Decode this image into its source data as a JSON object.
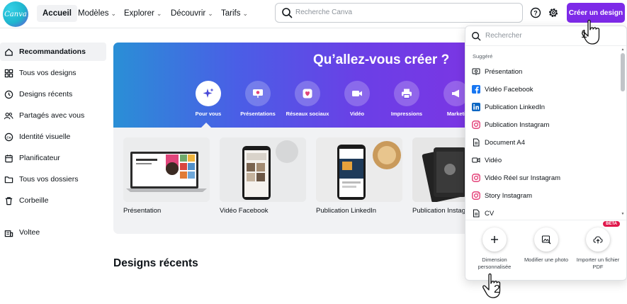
{
  "brand": {
    "logo_text": "Canva",
    "accent": "#7d2ae8"
  },
  "topnav": {
    "items": [
      {
        "label": "Accueil",
        "active": true
      },
      {
        "label": "Modèles",
        "dropdown": true
      },
      {
        "label": "Explorer",
        "dropdown": true
      },
      {
        "label": "Découvrir",
        "dropdown": true
      },
      {
        "label": "Tarifs",
        "dropdown": true
      }
    ],
    "search_placeholder": "Recherche Canva",
    "create_button": "Créer un design"
  },
  "sidebar": {
    "items": [
      {
        "label": "Recommandations",
        "icon": "home-icon",
        "active": true
      },
      {
        "label": "Tous vos designs",
        "icon": "grid-icon"
      },
      {
        "label": "Designs récents",
        "icon": "clock-icon"
      },
      {
        "label": "Partagés avec vous",
        "icon": "people-icon"
      },
      {
        "label": "Identité visuelle",
        "icon": "brand-icon"
      },
      {
        "label": "Planificateur",
        "icon": "calendar-icon"
      },
      {
        "label": "Tous vos dossiers",
        "icon": "folder-icon"
      },
      {
        "label": "Corbeille",
        "icon": "trash-icon"
      },
      {
        "label": "Voltee",
        "icon": "team-icon"
      }
    ]
  },
  "hero": {
    "title": "Qu’allez-vous créer ?",
    "categories": [
      {
        "label": "Pour vous",
        "icon": "sparkle-icon",
        "active": true
      },
      {
        "label": "Présentations",
        "icon": "presentation-icon"
      },
      {
        "label": "Réseaux sociaux",
        "icon": "heart-icon"
      },
      {
        "label": "Vidéo",
        "icon": "video-icon"
      },
      {
        "label": "Impressions",
        "icon": "printer-icon"
      },
      {
        "label": "Marketi",
        "icon": "megaphone-icon"
      }
    ]
  },
  "cards": [
    {
      "label": "Présentation"
    },
    {
      "label": "Vidéo Facebook"
    },
    {
      "label": "Publication LinkedIn"
    },
    {
      "label": "Publication Instag"
    }
  ],
  "recent": {
    "title": "Designs récents"
  },
  "dropdown": {
    "search_placeholder": "Rechercher",
    "section": "Suggéré",
    "items": [
      {
        "label": "Présentation",
        "icon": "presentation-icon"
      },
      {
        "label": "Vidéo Facebook",
        "icon": "facebook-icon"
      },
      {
        "label": "Publication LinkedIn",
        "icon": "linkedin-icon"
      },
      {
        "label": "Publication Instagram",
        "icon": "instagram-icon"
      },
      {
        "label": "Document A4",
        "icon": "document-icon"
      },
      {
        "label": "Vidéo",
        "icon": "video-icon"
      },
      {
        "label": "Vidéo Réel sur Instagram",
        "icon": "instagram-icon"
      },
      {
        "label": "Story Instagram",
        "icon": "instagram-icon"
      },
      {
        "label": "CV",
        "icon": "document-icon"
      }
    ],
    "actions": [
      {
        "label": "Dimension personnalisée",
        "icon": "plus-icon"
      },
      {
        "label": "Modifier une photo",
        "icon": "photo-edit-icon"
      },
      {
        "label": "Importer un fichier PDF",
        "icon": "upload-cloud-icon",
        "badge": "BÊTA"
      }
    ]
  },
  "annotations": {
    "step1": "1",
    "step2": "2"
  }
}
